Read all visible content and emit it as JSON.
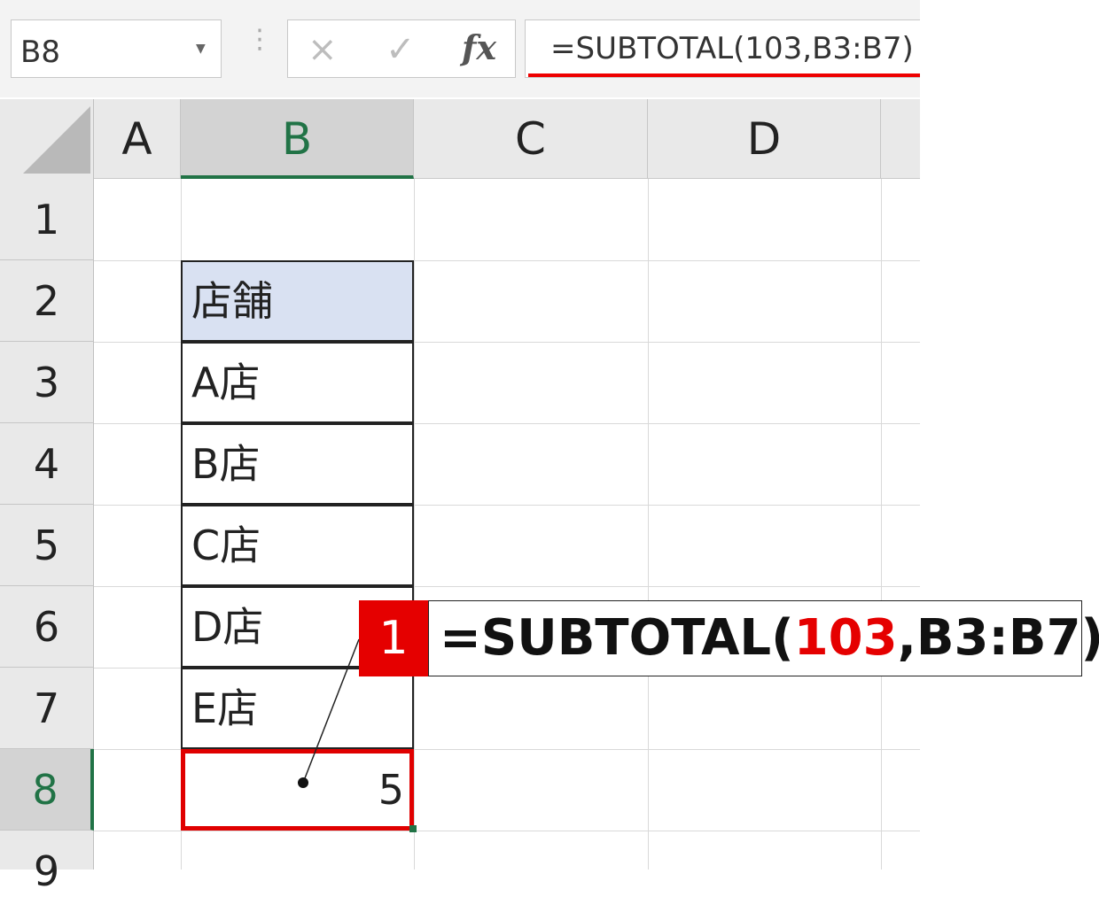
{
  "name_box": {
    "value": "B8"
  },
  "formula_bar": {
    "cancel_icon": "×",
    "enter_icon": "✓",
    "fx_label": "fx",
    "formula": "=SUBTOTAL(103,B3:B7)"
  },
  "columns": [
    "A",
    "B",
    "C",
    "D"
  ],
  "rows": [
    "1",
    "2",
    "3",
    "4",
    "5",
    "6",
    "7",
    "8",
    "9"
  ],
  "selected_cell": {
    "column": "B",
    "row": "8"
  },
  "table": {
    "header": "店舗",
    "items": [
      "A店",
      "B店",
      "C店",
      "D店",
      "E店"
    ],
    "result": "5"
  },
  "callout": {
    "badge": "1",
    "prefix": "=SUBTOTAL(",
    "highlight": "103",
    "suffix": ",B3:B7)"
  },
  "colors": {
    "accent_green": "#217346",
    "highlight_red": "#e50000",
    "header_fill": "#d9e1f2"
  }
}
